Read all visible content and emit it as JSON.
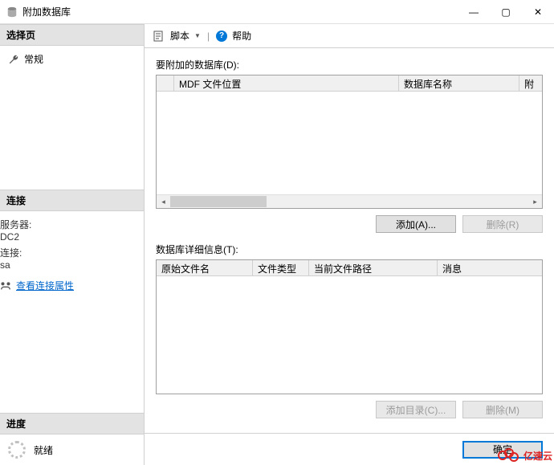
{
  "window": {
    "title": "附加数据库",
    "minimize": "—",
    "maximize": "▢",
    "close": "✕"
  },
  "left": {
    "select_page_hdr": "选择页",
    "general": "常规",
    "connection_hdr": "连接",
    "server_label": "服务器:",
    "server_value": "DC2",
    "conn_label": "连接:",
    "conn_value": "sa",
    "view_props": "查看连接属性",
    "progress_hdr": "进度",
    "progress_status": "就绪"
  },
  "toolbar": {
    "script": "脚本",
    "help": "帮助"
  },
  "main": {
    "attach_label": "要附加的数据库(D):",
    "grid1_cols": {
      "rowhead": "",
      "mdf": "MDF 文件位置",
      "dbname": "数据库名称",
      "attach": "附"
    },
    "add_btn": "添加(A)...",
    "remove_btn": "删除(R)",
    "details_label": "数据库详细信息(T):",
    "grid2_cols": {
      "orig": "原始文件名",
      "type": "文件类型",
      "path": "当前文件路径",
      "msg": "消息"
    },
    "add_dir_btn": "添加目录(C)...",
    "remove2_btn": "删除(M)"
  },
  "footer": {
    "ok": "确定"
  },
  "watermark": "亿速云"
}
